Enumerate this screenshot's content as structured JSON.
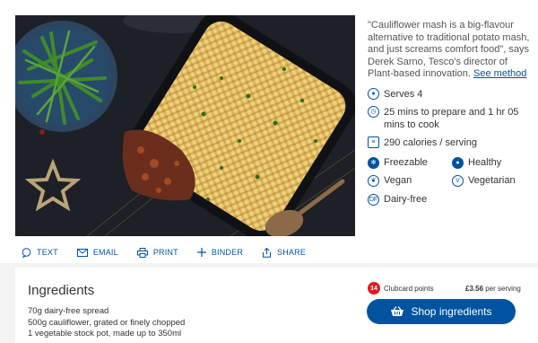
{
  "description": {
    "quote": "\"Cauliflower mash is a big-flavour alternative to traditional potato mash, and just screams comfort food\", says Derek Sarno, Tesco's director of Plant-based innovation.",
    "see_method": "See method"
  },
  "meta": {
    "serves": "Serves 4",
    "time": "25 mins to prepare and 1 hr 05 mins to cook",
    "calories": "290 calories / serving"
  },
  "diet": [
    {
      "label": "Freezable",
      "icon": "snowflake-icon"
    },
    {
      "label": "Healthy",
      "icon": "healthy-icon"
    },
    {
      "label": "Vegan",
      "icon": "vegan-icon"
    },
    {
      "label": "Vegetarian",
      "icon": "vegetarian-icon"
    },
    {
      "label": "Dairy-free",
      "icon": "dairy-free-icon"
    }
  ],
  "actions": {
    "text": "TEXT",
    "email": "EMAIL",
    "print": "PRINT",
    "binder": "BINDER",
    "share": "SHARE"
  },
  "ingredients": {
    "title": "Ingredients",
    "items": [
      "70g dairy-free spread",
      "500g cauliflower, grated or finely chopped",
      "1 vegetable stock pot, made up to 350ml"
    ]
  },
  "clubcard": {
    "points": "14",
    "label": "Clubcard points"
  },
  "price": {
    "amount": "£3.56",
    "suffix": " per serving"
  },
  "shop_button": "Shop ingredients",
  "colors": {
    "accent": "#00539f",
    "clubcard_red": "#e21b24"
  }
}
